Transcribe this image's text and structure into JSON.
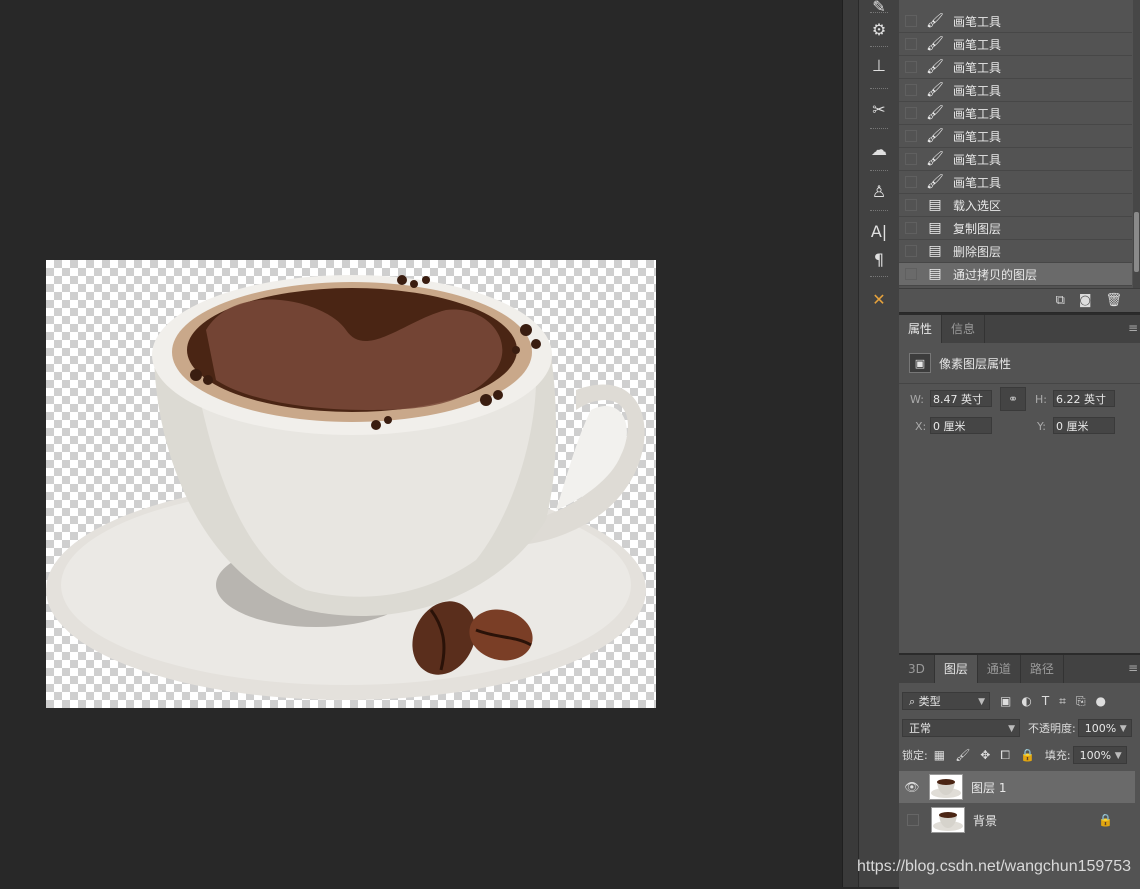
{
  "history": {
    "items": [
      {
        "label": "画笔工具",
        "icon": "brush-icon"
      },
      {
        "label": "画笔工具",
        "icon": "brush-icon"
      },
      {
        "label": "画笔工具",
        "icon": "brush-icon"
      },
      {
        "label": "画笔工具",
        "icon": "brush-icon"
      },
      {
        "label": "画笔工具",
        "icon": "brush-icon"
      },
      {
        "label": "画笔工具",
        "icon": "brush-icon"
      },
      {
        "label": "画笔工具",
        "icon": "brush-icon"
      },
      {
        "label": "画笔工具",
        "icon": "brush-icon"
      },
      {
        "label": "载入选区",
        "icon": "document-icon"
      },
      {
        "label": "复制图层",
        "icon": "document-icon"
      },
      {
        "label": "删除图层",
        "icon": "document-icon"
      },
      {
        "label": "通过拷贝的图层",
        "icon": "document-icon",
        "selected": true
      }
    ]
  },
  "properties": {
    "tabs": [
      "属性",
      "信息"
    ],
    "title": "像素图层属性",
    "w_label": "W:",
    "w_value": "8.47 英寸",
    "h_label": "H:",
    "h_value": "6.22 英寸",
    "x_label": "X:",
    "x_value": "0 厘米",
    "y_label": "Y:",
    "y_value": "0 厘米"
  },
  "layers_panel": {
    "tabs": [
      "3D",
      "图层",
      "通道",
      "路径"
    ],
    "filter_kind": "类型",
    "blend_mode": "正常",
    "opacity_label": "不透明度:",
    "opacity_value": "100%",
    "lock_label": "锁定:",
    "fill_label": "填充:",
    "fill_value": "100%",
    "layers": [
      {
        "name": "图层 1",
        "visible": true,
        "selected": true
      },
      {
        "name": "背景",
        "visible": false,
        "locked": true
      }
    ]
  },
  "watermark": "https://blog.csdn.net/wangchun159753",
  "colors": {
    "panel_bg": "#535353",
    "canvas_bg": "#282828",
    "selected_row": "#6a6a6a",
    "tool_accent": "#e6a23c"
  }
}
